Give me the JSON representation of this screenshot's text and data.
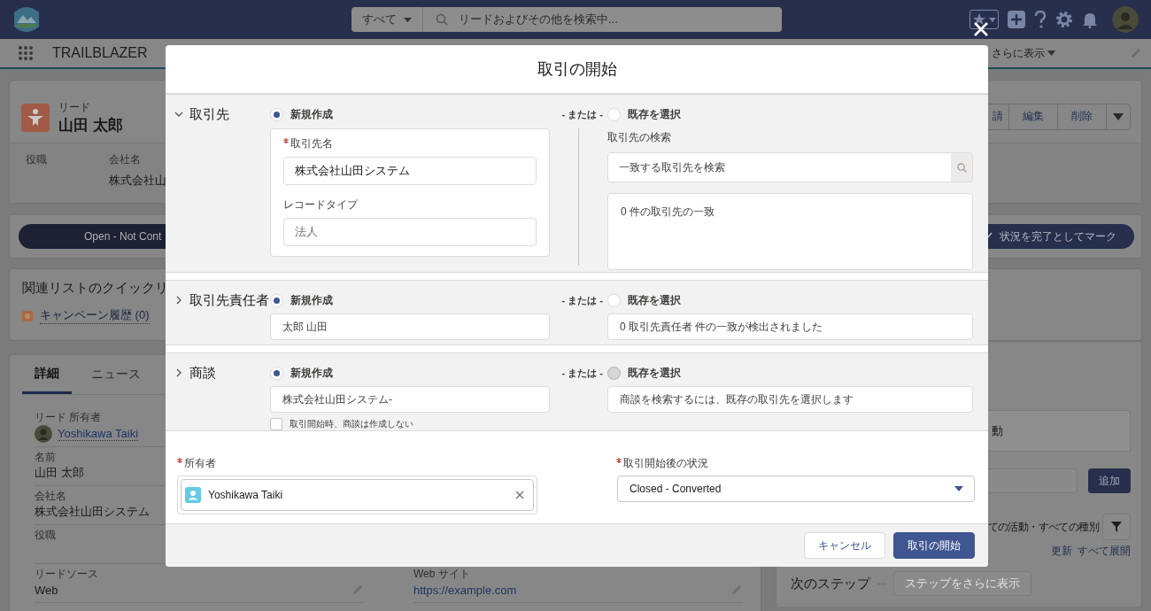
{
  "header": {
    "search_scope": "すべて",
    "search_placeholder": "リードおよびその他を検索中..."
  },
  "nav": {
    "app_name": "TRAILBLAZER",
    "more": "さらに表示"
  },
  "record": {
    "object": "リード",
    "name": "山田 太郎",
    "actions": [
      "請",
      "編集",
      "削除"
    ],
    "fields": [
      {
        "label": "役職"
      },
      {
        "label": "会社名",
        "value": "株式会社山"
      }
    ]
  },
  "path": {
    "current": "Open - Not Cont",
    "mark_button": "状況を完了としてマーク"
  },
  "quick_links": {
    "title": "関連リストのクイックリ",
    "items": [
      "キャンペーン履歴 (0)"
    ]
  },
  "details": {
    "tabs": [
      {
        "label": "詳細",
        "selected": true
      },
      {
        "label": "ニュース",
        "selected": false
      }
    ],
    "fields": [
      {
        "label": "リード 所有者",
        "value": "Yoshikawa Taiki",
        "kind": "user"
      },
      {
        "label": "名前",
        "value": "山田 太郎",
        "kind": "text"
      },
      {
        "label": "会社名",
        "value": "株式会社山田システム",
        "kind": "text"
      },
      {
        "label": "役職"
      }
    ],
    "bottom_fields": [
      {
        "label": "リードソース",
        "value": "Web",
        "kind": "text"
      },
      {
        "label": "Web サイト",
        "value": "https://example.com",
        "kind": "link"
      }
    ]
  },
  "activity": {
    "tab_partial": "動",
    "add_button": "追加",
    "filter_text": "ての活動・すべての種別",
    "links": [
      "更新",
      "すべて展開"
    ],
    "next_steps": "次のステップ",
    "more_steps": "ステップをさらに表示"
  },
  "modal": {
    "title": "取引の開始",
    "sections": [
      {
        "kind": "account",
        "title": "取引先",
        "expanded": true,
        "new": {
          "label": "新規作成",
          "selected": true
        },
        "separator": "- または -",
        "existing": {
          "label": "既存を選択",
          "selected": false,
          "disabled": false
        },
        "fields": [
          {
            "label": "取引先名",
            "required": true,
            "value": "株式会社山田システム",
            "disabled": false
          },
          {
            "label": "レコードタイプ",
            "required": false,
            "value": "法人",
            "disabled": true
          }
        ],
        "search": {
          "label": "取引先の検索",
          "placeholder": "一致する取引先を検索"
        },
        "results": "0 件の取引先の一致"
      },
      {
        "kind": "contact",
        "title": "取引先責任者",
        "expanded": false,
        "new": {
          "label": "新規作成",
          "selected": true
        },
        "separator": "- または -",
        "existing": {
          "label": "既存を選択",
          "selected": false,
          "disabled": false
        },
        "value": "太郎 山田",
        "results": "0 取引先責任者 件の一致が検出されました"
      },
      {
        "kind": "opportunity",
        "title": "商談",
        "expanded": false,
        "new": {
          "label": "新規作成",
          "selected": true
        },
        "separator": "- または -",
        "existing": {
          "label": "既存を選択",
          "selected": false,
          "disabled": true
        },
        "value": "株式会社山田システム-",
        "checkbox": {
          "label": "取引開始時、商談は作成しない",
          "checked": false
        },
        "results": "商談を検索するには、既存の取引先を選択します"
      }
    ],
    "owner": {
      "label": "所有者",
      "required": true,
      "value": "Yoshikawa Taiki"
    },
    "status": {
      "label": "取引開始後の状況",
      "required": true,
      "value": "Closed - Converted"
    },
    "buttons": [
      {
        "label": "キャンセル",
        "kind": "neutral"
      },
      {
        "label": "取引の開始",
        "kind": "brand"
      }
    ]
  }
}
